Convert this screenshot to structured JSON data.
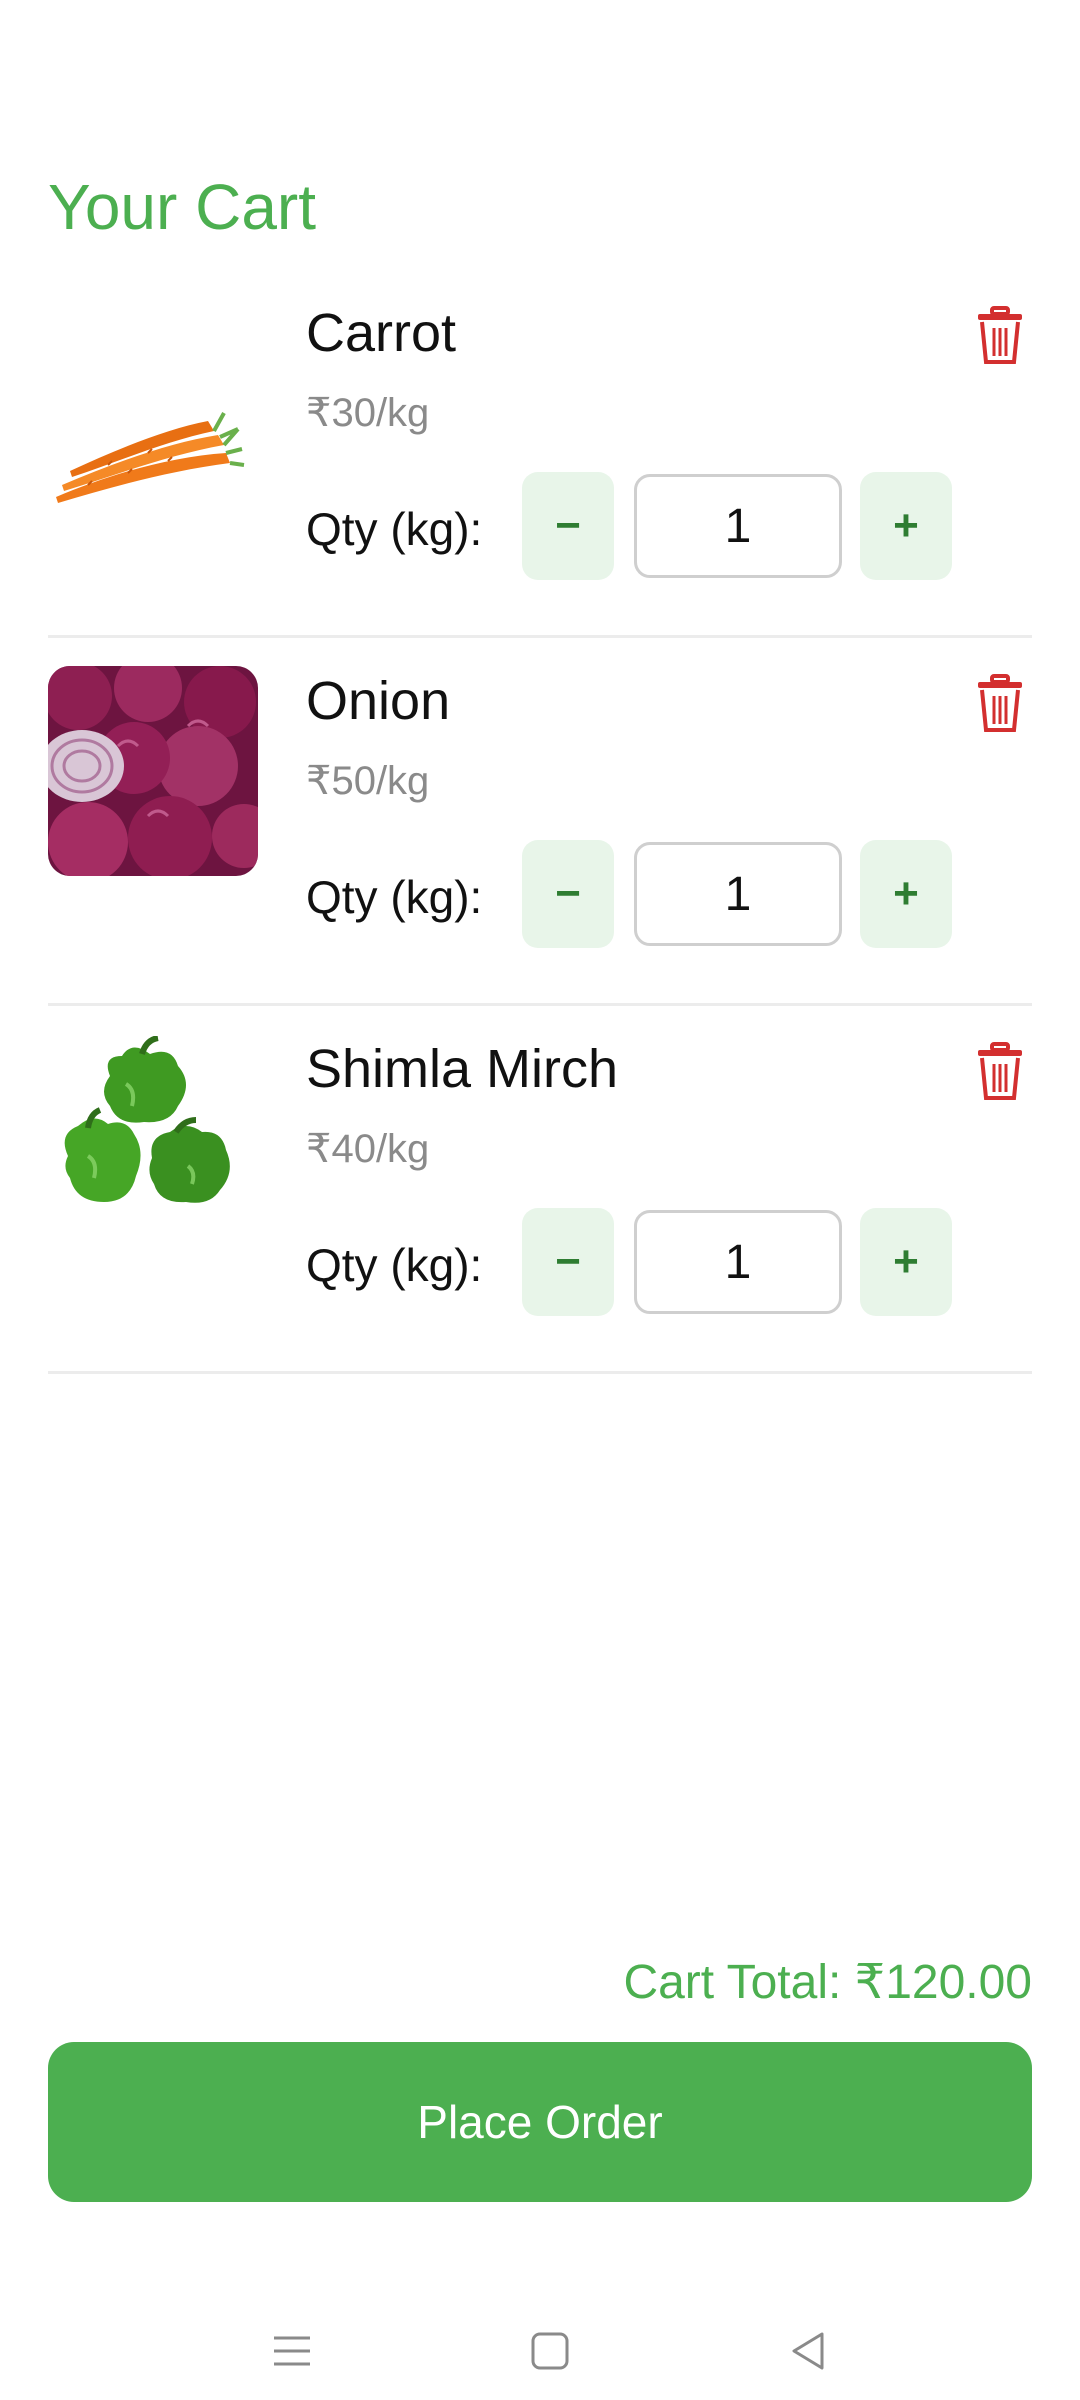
{
  "header": {
    "title": "Your Cart"
  },
  "cart": {
    "qty_label": "Qty (kg):",
    "minus_label": "−",
    "plus_label": "+",
    "items": [
      {
        "name": "Carrot",
        "price": "₹30/kg",
        "qty": "1",
        "image": "carrot-image"
      },
      {
        "name": "Onion",
        "price": "₹50/kg",
        "qty": "1",
        "image": "onion-image"
      },
      {
        "name": "Shimla Mirch",
        "price": "₹40/kg",
        "qty": "1",
        "image": "bell-pepper-image"
      }
    ]
  },
  "footer": {
    "total": "Cart Total: ₹120.00",
    "place_order_label": "Place Order"
  },
  "colors": {
    "accent": "#4caf50",
    "stepper_bg": "#e8f5e9",
    "stepper_fg": "#2e7d32",
    "delete": "#d32f2f",
    "price_text": "#8a8a8a"
  },
  "system_nav": {
    "icons": [
      "menu-icon",
      "home-icon",
      "back-icon"
    ]
  }
}
